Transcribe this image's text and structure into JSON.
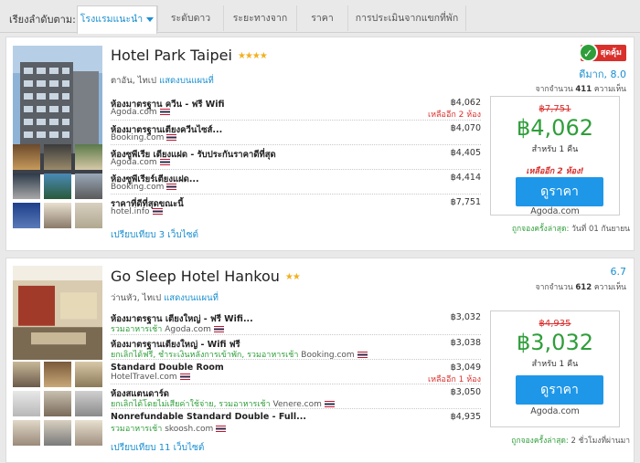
{
  "sortbar": {
    "label": "เรียงลำดับตาม:",
    "tabs": [
      {
        "label": "โรงแรมแนะนำ",
        "active": true
      },
      {
        "label": "ระดับดาว",
        "active": false
      },
      {
        "label": "ระยะทางจาก",
        "active": false
      },
      {
        "label": "ราคา",
        "active": false
      },
      {
        "label": "การประเมินจากแขกที่พัก",
        "active": false
      }
    ]
  },
  "hotels": [
    {
      "name": "Hotel Park Taipei",
      "stars": "★★★★",
      "location": "ตาอัน, ไทเป",
      "map_link": "แสดงบนแผนที่",
      "badge": "สุดคุ้ม",
      "score_text": "ดีมาก, 8.0",
      "reviews_prefix": "จากจำนวน",
      "reviews_count": "411",
      "reviews_suffix": "ความเห็น",
      "rooms": [
        {
          "name": "ห้องมาตรฐาน ควีน - ฟรี Wifi",
          "site": "Agoda.com",
          "perks": "",
          "price": "฿4,062",
          "left": "เหลืออีก 2 ห้อง"
        },
        {
          "name": "ห้องมาตรฐานเตียงควีนไซส์...",
          "site": "Booking.com",
          "perks": "",
          "price": "฿4,070",
          "left": ""
        },
        {
          "name": "ห้องซูพีเรีย เตียงแฝด - รับประกันราคาดีที่สุด",
          "site": "Agoda.com",
          "perks": "",
          "price": "฿4,405",
          "left": ""
        },
        {
          "name": "ห้องซูพีเรียร์เตียงแฝด...",
          "site": "Booking.com",
          "perks": "",
          "price": "฿4,414",
          "left": ""
        },
        {
          "name": "ราคาที่ดีที่สุดขณะนี้",
          "site": "hotel.info",
          "perks": "",
          "price": "฿7,751",
          "left": ""
        }
      ],
      "compare": "เปรียบเทียบ 3 เว็บไซต์",
      "old_price": "฿7,751",
      "price": "฿4,062",
      "per_night": "สำหรับ 1 คืน",
      "left_alert": "เหลืออีก 2 ห้อง!",
      "button": "ดูราคา",
      "button_site": "Agoda.com",
      "booked_label": "ถูกจองครั้งล่าสุด:",
      "booked_time": "วันที่ 01 กันยายน"
    },
    {
      "name": "Go Sleep Hotel Hankou",
      "stars": "★★",
      "location": "ว่านหัว, ไทเป",
      "map_link": "แสดงบนแผนที่",
      "score_text": "6.7",
      "reviews_prefix": "จากจำนวน",
      "reviews_count": "612",
      "reviews_suffix": "ความเห็น",
      "rooms": [
        {
          "name": "ห้องมาตรฐาน เตียงใหญ่ - ฟรี Wifi...",
          "site": "Agoda.com",
          "perks": "รวมอาหารเช้า",
          "price": "฿3,032",
          "left": ""
        },
        {
          "name": "ห้องมาตรฐานเตียงใหญ่ - Wifi ฟรี",
          "site": "Booking.com",
          "perks": "ยกเลิกได้ฟรี, ชำระเงินหลังการเข้าพัก, รวมอาหารเช้า",
          "price": "฿3,038",
          "left": ""
        },
        {
          "name": "Standard Double Room",
          "site": "HotelTravel.com",
          "perks": "",
          "price": "฿3,049",
          "left": "เหลืออีก 1 ห้อง"
        },
        {
          "name": "ห้องสแตนดาร์ด",
          "site": "Venere.com",
          "perks": "ยกเลิกได้โดยไม่เสียค่าใช้จ่าย, รวมอาหารเช้า",
          "price": "฿3,050",
          "left": ""
        },
        {
          "name": "Nonrefundable Standard Double - Full...",
          "site": "skoosh.com",
          "perks": "รวมอาหารเช้า",
          "price": "฿4,935",
          "left": ""
        }
      ],
      "compare": "เปรียบเทียบ 11 เว็บไซต์",
      "old_price": "฿4,935",
      "price": "฿3,032",
      "per_night": "สำหรับ 1 คืน",
      "button": "ดูราคา",
      "button_site": "Agoda.com",
      "booked_label": "ถูกจองครั้งล่าสุด:",
      "booked_time": "2 ชั่วโมงที่ผ่านมา"
    }
  ]
}
